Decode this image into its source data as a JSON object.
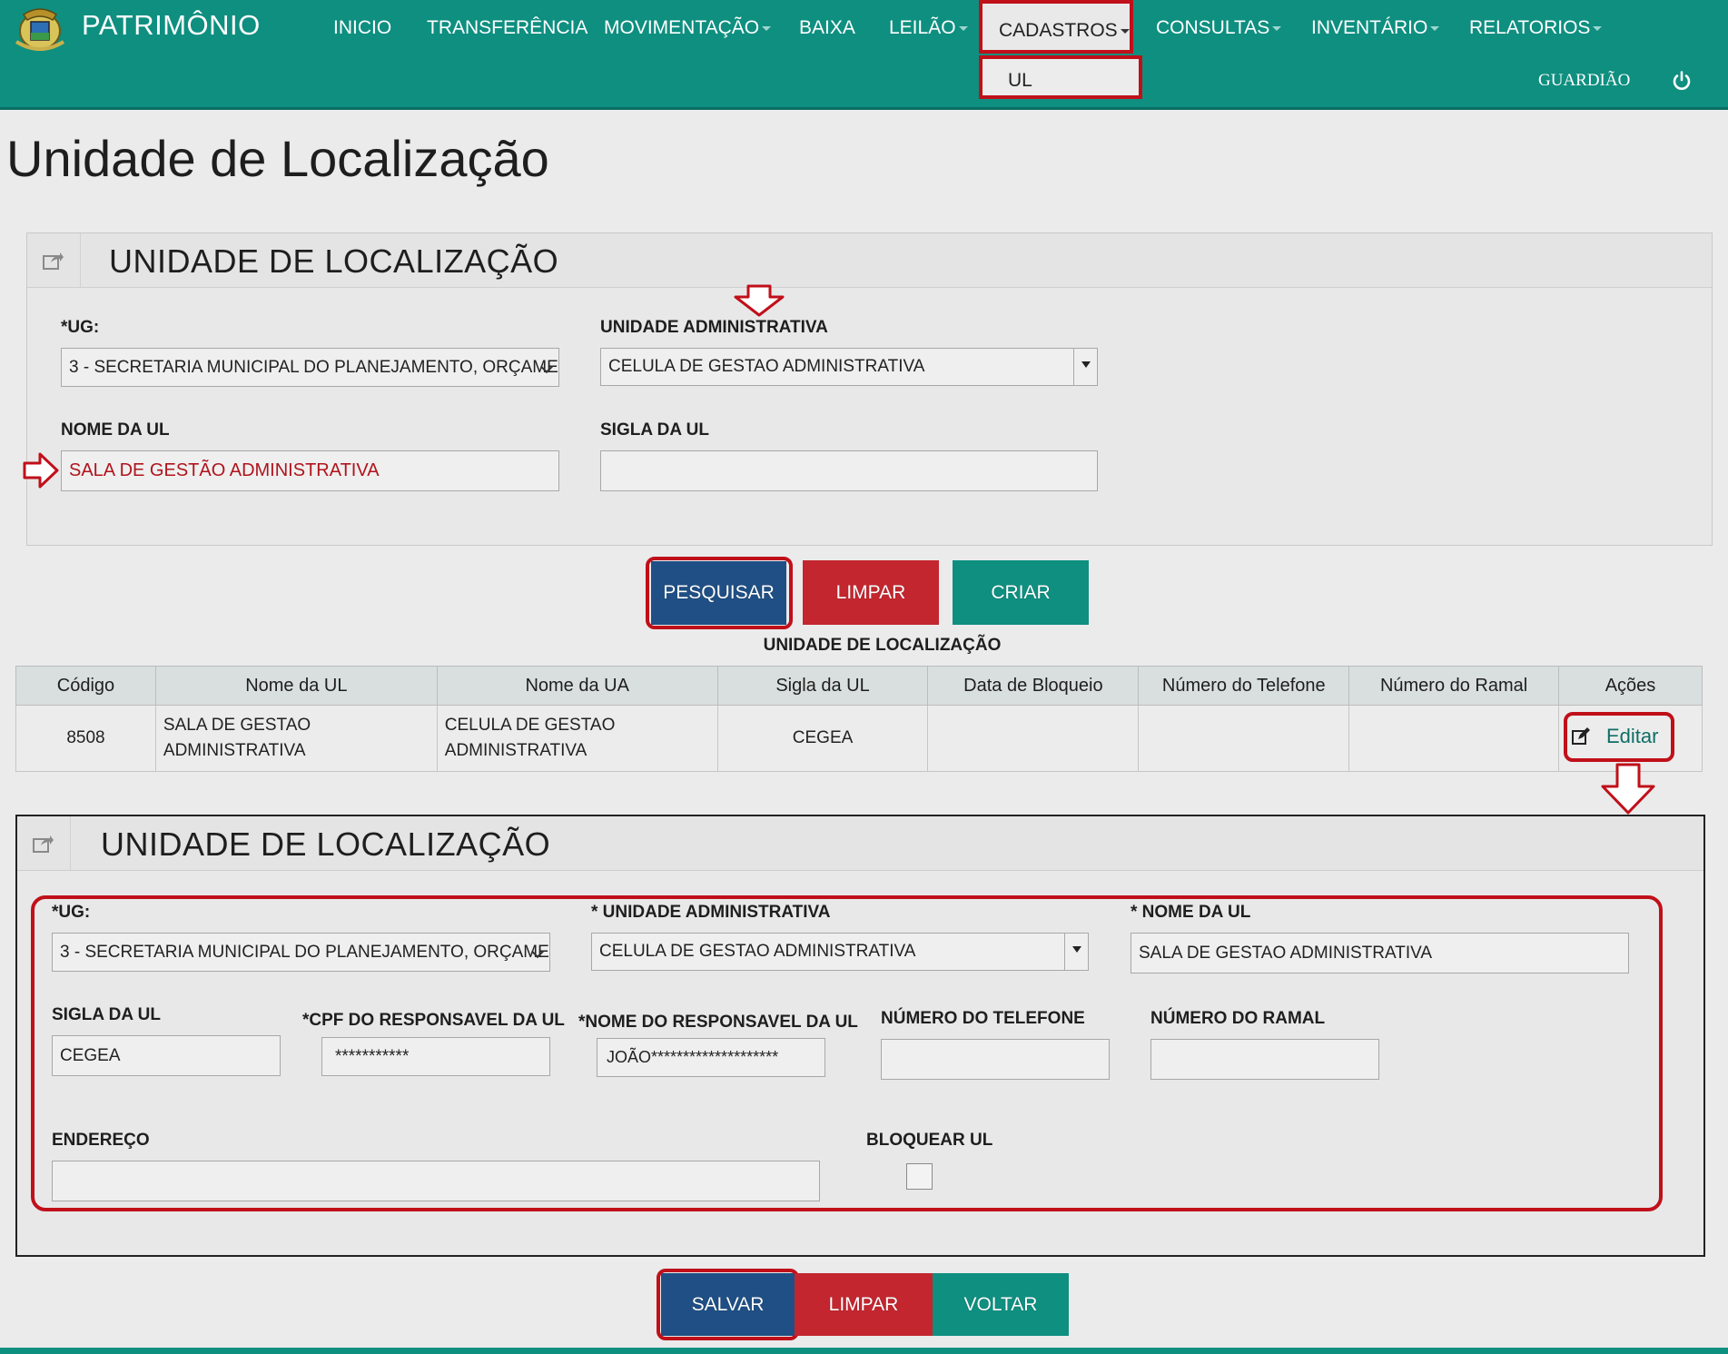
{
  "app": {
    "brand": "PATRIMÔNIO",
    "user": "GUARDIÃO"
  },
  "nav": {
    "items": [
      {
        "label": "INICIO"
      },
      {
        "label": "TRANSFERÊNCIA"
      },
      {
        "label": "MOVIMENTAÇÃO"
      },
      {
        "label": "BAIXA"
      },
      {
        "label": "LEILÃO"
      },
      {
        "label": "CADASTROS"
      },
      {
        "label": "CONSULTAS"
      },
      {
        "label": "INVENTÁRIO"
      },
      {
        "label": "RELATORIOS"
      }
    ],
    "dropdown_item": "UL"
  },
  "page_title": "Unidade de Localização",
  "search_panel": {
    "title": "UNIDADE DE LOCALIZAÇÃO",
    "ug_label": "*UG:",
    "ug_value": "3 - SECRETARIA MUNICIPAL DO PLANEJAMENTO, ORÇAME",
    "ua_label": "UNIDADE ADMINISTRATIVA",
    "ua_value": "CELULA DE GESTAO ADMINISTRATIVA",
    "nome_label": "NOME DA UL",
    "nome_value": "SALA DE GESTÃO ADMINISTRATIVA",
    "sigla_label": "SIGLA DA UL",
    "sigla_value": ""
  },
  "search_buttons": {
    "search": "PESQUISAR",
    "clear": "LIMPAR",
    "create": "CRIAR"
  },
  "results": {
    "caption": "UNIDADE DE LOCALIZAÇÃO",
    "columns": [
      "Código",
      "Nome da UL",
      "Nome da UA",
      "Sigla da UL",
      "Data de Bloqueio",
      "Número do Telefone",
      "Número do Ramal",
      "Ações"
    ],
    "rows": [
      {
        "codigo": "8508",
        "nome_ul": "SALA DE GESTAO ADMINISTRATIVA",
        "nome_ua": "CELULA DE GESTAO ADMINISTRATIVA",
        "sigla": "CEGEA",
        "data_bloqueio": "",
        "telefone": "",
        "ramal": "",
        "acao": "Editar"
      }
    ]
  },
  "edit_panel": {
    "title": "UNIDADE DE LOCALIZAÇÃO",
    "ug_label": "*UG:",
    "ug_value": "3 - SECRETARIA MUNICIPAL DO PLANEJAMENTO, ORÇAME",
    "ua_label": "* UNIDADE ADMINISTRATIVA",
    "ua_value": "CELULA DE GESTAO ADMINISTRATIVA",
    "nome_label": "* NOME DA UL",
    "nome_value": "SALA DE GESTAO ADMINISTRATIVA",
    "sigla_label": "SIGLA DA UL",
    "sigla_value": "CEGEA",
    "cpf_label": "*CPF DO RESPONSAVEL DA UL",
    "cpf_value": "***********",
    "resp_label": "*NOME DO RESPONSAVEL DA UL",
    "resp_value": "JOÃO********************",
    "tel_label": "NÚMERO DO TELEFONE",
    "tel_value": "",
    "ramal_label": "NÚMERO DO RAMAL",
    "ramal_value": "",
    "endereco_label": "ENDEREÇO",
    "endereco_value": "",
    "bloquear_label": "BLOQUEAR UL",
    "bloquear_checked": false
  },
  "edit_buttons": {
    "save": "SALVAR",
    "clear": "LIMPAR",
    "back": "VOLTAR"
  },
  "colors": {
    "primary_teal": "#0e8f80",
    "blue": "#1f4f84",
    "red": "#c3262f",
    "highlight": "#c0101a"
  }
}
